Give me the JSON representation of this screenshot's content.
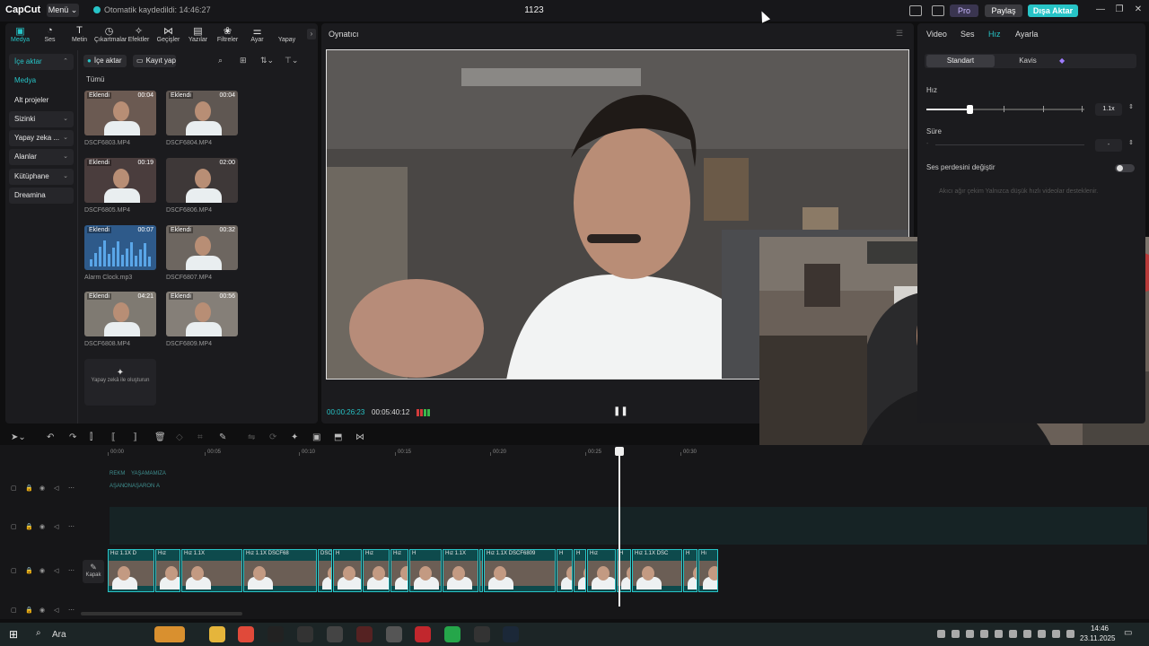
{
  "topbar": {
    "logo": "CapCut",
    "menu": "Menü",
    "autosave": "Otomatik kaydedildi: 14:46:27",
    "project_title": "1123",
    "pro": "Pro",
    "share": "Paylaş",
    "export": "Dışa Aktar"
  },
  "tool_tabs": [
    {
      "label": "Medya",
      "icon": "media-icon",
      "glyph": "▣"
    },
    {
      "label": "Ses",
      "icon": "audio-icon",
      "glyph": "◔"
    },
    {
      "label": "Metin",
      "icon": "text-icon",
      "glyph": "T"
    },
    {
      "label": "Çıkartmalar",
      "icon": "sticker-icon",
      "glyph": "◷"
    },
    {
      "label": "Efektler",
      "icon": "effects-icon",
      "glyph": "✧"
    },
    {
      "label": "Geçişler",
      "icon": "transitions-icon",
      "glyph": "⋈"
    },
    {
      "label": "Yazılar",
      "icon": "captions-icon",
      "glyph": "▤"
    },
    {
      "label": "Filtreler",
      "icon": "filters-icon",
      "glyph": "❀"
    },
    {
      "label": "Ayar",
      "icon": "adjust-icon",
      "glyph": "⚌"
    },
    {
      "label": "Yapay",
      "icon": "ai-icon",
      "glyph": ""
    }
  ],
  "sidenav": [
    {
      "label": "İçe aktar",
      "group": true,
      "active": true,
      "chev": "⌃"
    },
    {
      "label": "Medya",
      "group": false,
      "active": true,
      "chev": ""
    },
    {
      "label": "Alt projeler",
      "group": false,
      "active": false,
      "chev": ""
    },
    {
      "label": "Sizinki",
      "group": true,
      "active": false,
      "chev": "⌄"
    },
    {
      "label": "Yapay zeka ...",
      "group": true,
      "active": false,
      "chev": "⌄"
    },
    {
      "label": "Alanlar",
      "group": true,
      "active": false,
      "chev": "⌄"
    },
    {
      "label": "Kütüphane",
      "group": true,
      "active": false,
      "chev": "⌄"
    },
    {
      "label": "Dreamina",
      "group": true,
      "active": false,
      "chev": ""
    }
  ],
  "media": {
    "import_label": "İçe aktar",
    "record_label": "Kayıt yap",
    "all_label": "Tümü",
    "items": [
      {
        "name": "DSCF6803.MP4",
        "tag": "Eklendi",
        "duration": "00:04"
      },
      {
        "name": "DSCF6804.MP4",
        "tag": "Eklendi",
        "duration": "00:04"
      },
      {
        "name": "DSCF6805.MP4",
        "tag": "Eklendi",
        "duration": "00:19"
      },
      {
        "name": "DSCF6806.MP4",
        "tag": "",
        "duration": "02:00"
      },
      {
        "name": "Alarm Clock.mp3",
        "tag": "Eklendi",
        "duration": "00:07"
      },
      {
        "name": "DSCF6807.MP4",
        "tag": "Eklendi",
        "duration": "00:32"
      },
      {
        "name": "DSCF6808.MP4",
        "tag": "Eklendi",
        "duration": "04:21"
      },
      {
        "name": "DSCF6809.MP4",
        "tag": "Eklendi",
        "duration": "00:56"
      }
    ],
    "ai_create": "Yapay zekâ ile oluşturun"
  },
  "player": {
    "label": "Oynatıcı",
    "timecode_current": "00:00:26:23",
    "timecode_total": "00:05:40:12"
  },
  "right_panel": {
    "tabs": [
      "Video",
      "Ses",
      "Hız",
      "Ayarla"
    ],
    "active_tab": "Hız",
    "seg_standard": "Standart",
    "seg_curve": "Kavis",
    "speed_label": "Hız",
    "speed_value": "1.1x",
    "speed_fraction": 0.27,
    "duration_label": "Süre",
    "duration_value": "-",
    "pitch_label": "Ses perdesini değiştir",
    "smooth_note": "Akıcı ağır çekim  Yalnızca düşük hızlı videolar desteklenir."
  },
  "timeline": {
    "ruler_labels": [
      "00:00",
      "00:05",
      "00:10",
      "00:15",
      "00:20",
      "00:25",
      "00:30"
    ],
    "text_track": [
      "REKM",
      "YAŞAMAMIZA",
      "AŞAN",
      "ONAŞARON",
      "A"
    ],
    "cover_label": "Kapak",
    "clips": [
      {
        "label": "Hız 1.1X  D"
      },
      {
        "label": "Hız"
      },
      {
        "label": "Hız 1.1X"
      },
      {
        "label": "Hız 1.1X  DSCF68"
      },
      {
        "label": "DSCF6809.MP4"
      },
      {
        "label": "H"
      },
      {
        "label": "Hız"
      },
      {
        "label": "Hız"
      },
      {
        "label": "H"
      },
      {
        "label": "Hız 1.1X"
      },
      {
        "label": "Hız"
      },
      {
        "label": "Hız 1.1X  DSCF6809"
      },
      {
        "label": "H"
      },
      {
        "label": "H"
      },
      {
        "label": "Hız"
      },
      {
        "label": "H"
      },
      {
        "label": "Hız 1.1X  DSC"
      },
      {
        "label": "H"
      },
      {
        "label": "Hı"
      }
    ]
  },
  "taskbar": {
    "search": "Ara",
    "time": "14:46",
    "date": "23.11.2025"
  },
  "colors": {
    "accent": "#27c4c7",
    "background": "#0f0f10",
    "panel": "#1b1b1e"
  }
}
